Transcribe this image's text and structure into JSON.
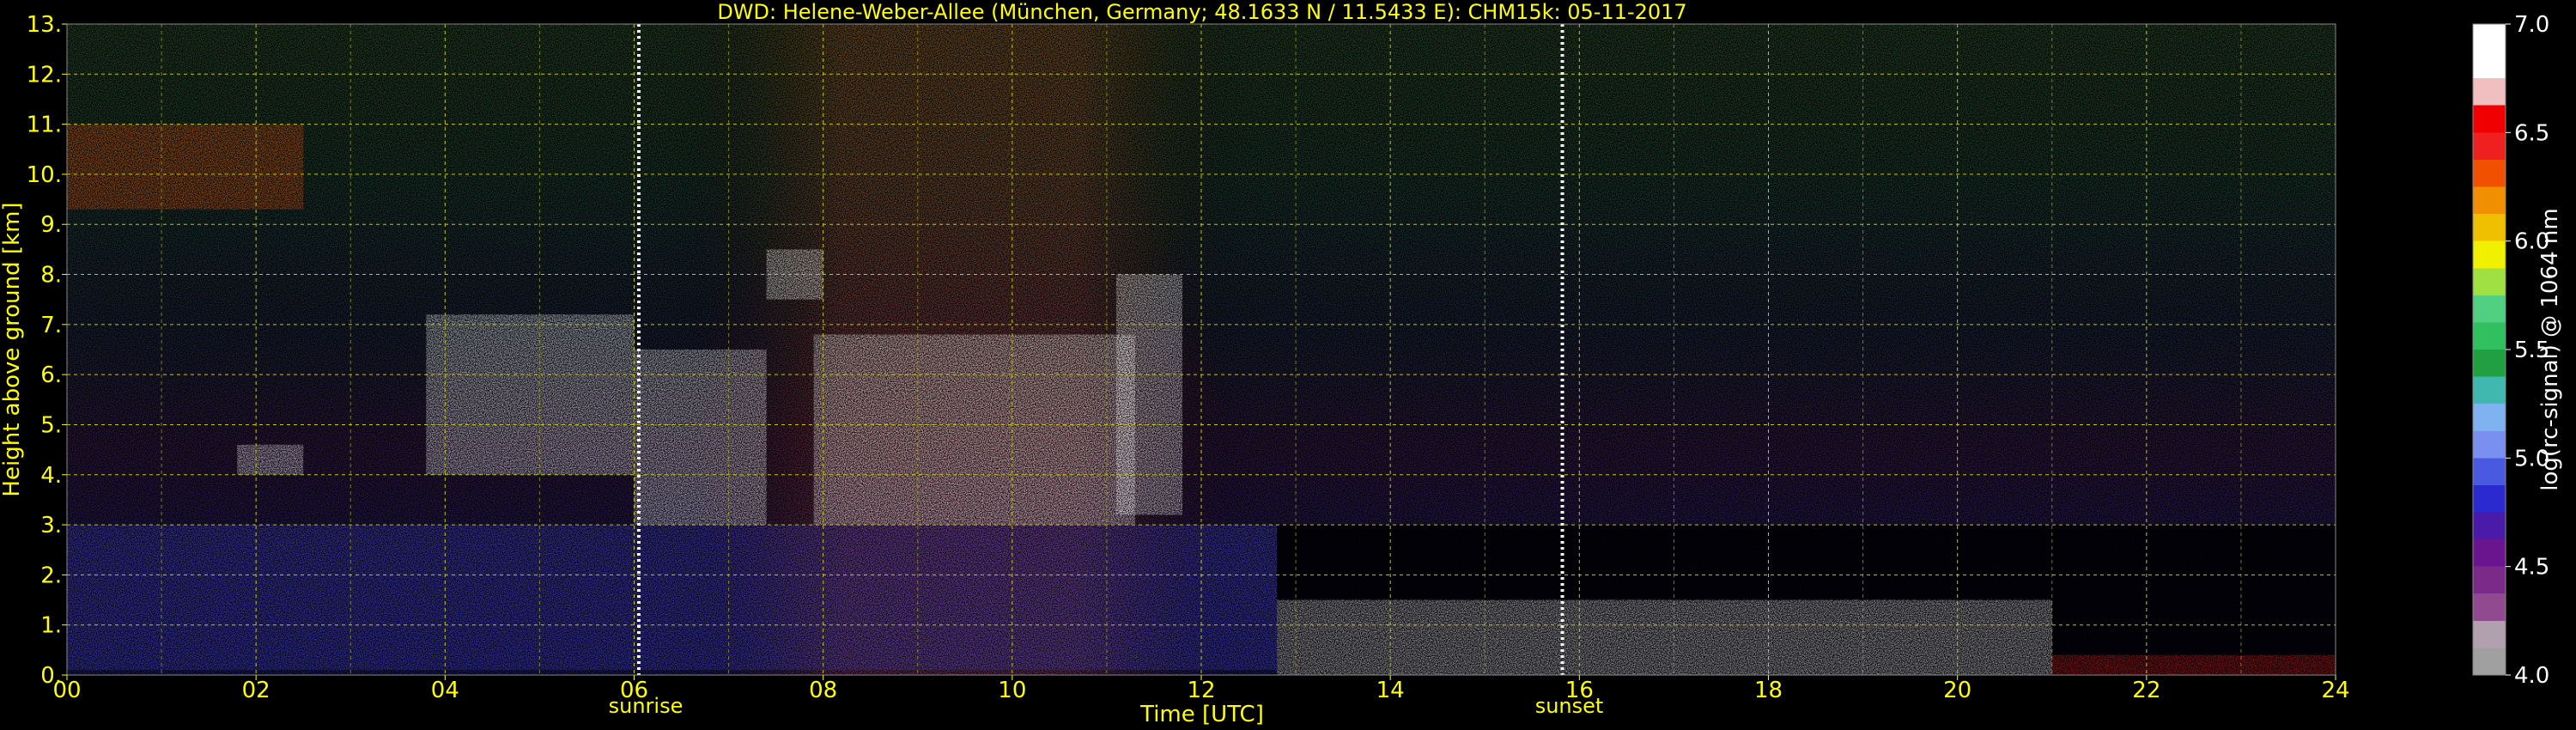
{
  "chart_data": {
    "type": "heatmap",
    "title": "DWD: Helene-Weber-Allee (München, Germany; 48.1633 N / 11.5433 E):    CHM15k: 05-11-2017",
    "xlabel": "Time [UTC]",
    "ylabel": "Height above ground [km]",
    "xlim": [
      0,
      24
    ],
    "ylim": [
      0,
      13
    ],
    "x_ticks": [
      "00",
      "02",
      "04",
      "06",
      "08",
      "10",
      "12",
      "14",
      "16",
      "18",
      "20",
      "22",
      "24"
    ],
    "y_ticks": [
      "0.",
      "1.",
      "2.",
      "3.",
      "4.",
      "5.",
      "6.",
      "7.",
      "8.",
      "9.",
      "10.",
      "11.",
      "12.",
      "13."
    ],
    "grid": true,
    "markers": [
      {
        "label": "sunrise",
        "x": 6.05
      },
      {
        "label": "sunset",
        "x": 15.82
      }
    ],
    "colorbar": {
      "label": "log(rc-signal) @ 1064 nm",
      "range": [
        4.0,
        7.0
      ],
      "ticks": [
        "4.0",
        "4.5",
        "5.0",
        "5.5",
        "6.0",
        "6.5",
        "7.0"
      ],
      "colors": [
        "#a0a0a0",
        "#b0a0b0",
        "#904a90",
        "#7c2a8a",
        "#6a1490",
        "#4a1aa8",
        "#2a2ad0",
        "#4a5ae0",
        "#7a90f0",
        "#7fb2f0",
        "#40b8b0",
        "#20a040",
        "#30c060",
        "#50d080",
        "#a0e040",
        "#f0f000",
        "#f0c000",
        "#f09000",
        "#f05000",
        "#f02020",
        "#f00000",
        "#f0c0c0",
        "#ffffff",
        "#ffffff"
      ]
    },
    "axis_color": "#ffff00",
    "cloud_layers": [
      {
        "t0": 0.0,
        "t1": 2.5,
        "h0": 9.3,
        "h1": 11.0,
        "color": "#f05000"
      },
      {
        "t0": 1.8,
        "t1": 2.5,
        "h0": 4.0,
        "h1": 4.6,
        "color": "#ffffff"
      },
      {
        "t0": 3.8,
        "t1": 6.0,
        "h0": 4.0,
        "h1": 7.2,
        "color": "#ffffff"
      },
      {
        "t0": 6.0,
        "t1": 7.4,
        "h0": 3.0,
        "h1": 6.5,
        "color": "#ffffff"
      },
      {
        "t0": 7.4,
        "t1": 8.0,
        "h0": 7.5,
        "h1": 8.5,
        "color": "#ffffff"
      },
      {
        "t0": 7.9,
        "t1": 11.3,
        "h0": 3.0,
        "h1": 6.8,
        "color": "#ffffff"
      },
      {
        "t0": 11.1,
        "t1": 11.8,
        "h0": 3.2,
        "h1": 8.0,
        "color": "#ffffff"
      },
      {
        "t0": 12.8,
        "t1": 21.0,
        "h0": 0.0,
        "h1": 1.5,
        "color": "#ffffff"
      },
      {
        "t0": 21.0,
        "t1": 24.0,
        "h0": 0.0,
        "h1": 0.4,
        "color": "#f02020"
      }
    ]
  }
}
